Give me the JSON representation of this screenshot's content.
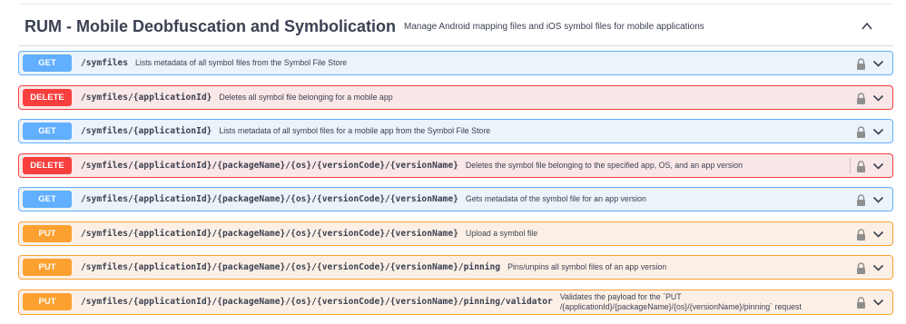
{
  "section": {
    "title": "RUM - Mobile Deobfuscation and Symbolication",
    "description": "Manage Android mapping files and iOS symbol files for mobile applications"
  },
  "operations": [
    {
      "method": "GET",
      "path": "/symfiles",
      "summary": "Lists metadata of all symbol files from the Symbol File Store"
    },
    {
      "method": "DELETE",
      "path": "/symfiles/{applicationId}",
      "summary": "Deletes all symbol file belonging for a mobile app"
    },
    {
      "method": "GET",
      "path": "/symfiles/{applicationId}",
      "summary": "Lists metadata of all symbol files for a mobile app from the Symbol File Store"
    },
    {
      "method": "DELETE",
      "path": "/symfiles/{applicationId}/{packageName}/{os}/{versionCode}/{versionName}",
      "summary": "Deletes the symbol file belonging to the specified app, OS, and an app version"
    },
    {
      "method": "GET",
      "path": "/symfiles/{applicationId}/{packageName}/{os}/{versionCode}/{versionName}",
      "summary": "Gets metadata of the symbol file for an app version"
    },
    {
      "method": "PUT",
      "path": "/symfiles/{applicationId}/{packageName}/{os}/{versionCode}/{versionName}",
      "summary": "Upload a symbol file"
    },
    {
      "method": "PUT",
      "path": "/symfiles/{applicationId}/{packageName}/{os}/{versionCode}/{versionName}/pinning",
      "summary": "Pins/unpins all symbol files of an app version"
    },
    {
      "method": "PUT",
      "path": "/symfiles/{applicationId}/{packageName}/{os}/{versionCode}/{versionName}/pinning/validator",
      "summary": "Validates the payload for the `PUT /{applicationId}/{packageName}/{os}/{versionName}/pinning` request"
    }
  ],
  "colors": {
    "get": "#61affe",
    "delete": "#f93e3e",
    "put": "#fca130"
  },
  "icons": {
    "lock": "lock-icon",
    "expand": "chevron-down-icon",
    "collapse": "chevron-up-icon"
  }
}
